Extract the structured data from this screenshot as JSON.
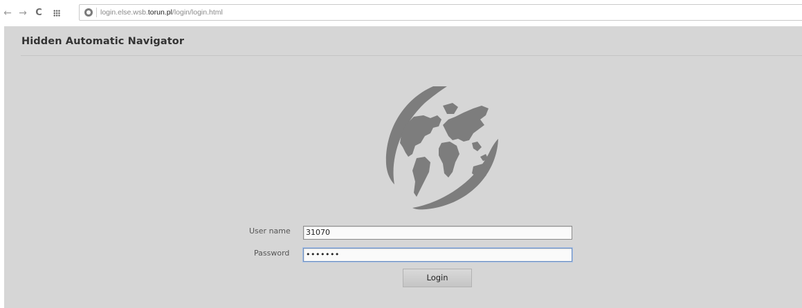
{
  "browser": {
    "url_prefix": "login.else.wsb.",
    "url_host": "torun.pl",
    "url_path": "/login/login.html",
    "back_icon": "←",
    "forward_icon": "→",
    "reload_icon": "C"
  },
  "app": {
    "title": "Hidden Automatic Navigator"
  },
  "form": {
    "username_label": "User name",
    "username_value": "31070",
    "password_label": "Password",
    "password_value": "•••••••",
    "login_label": "Login"
  },
  "colors": {
    "page_background": "#d6d6d6",
    "logo": "#7d7d7d"
  }
}
